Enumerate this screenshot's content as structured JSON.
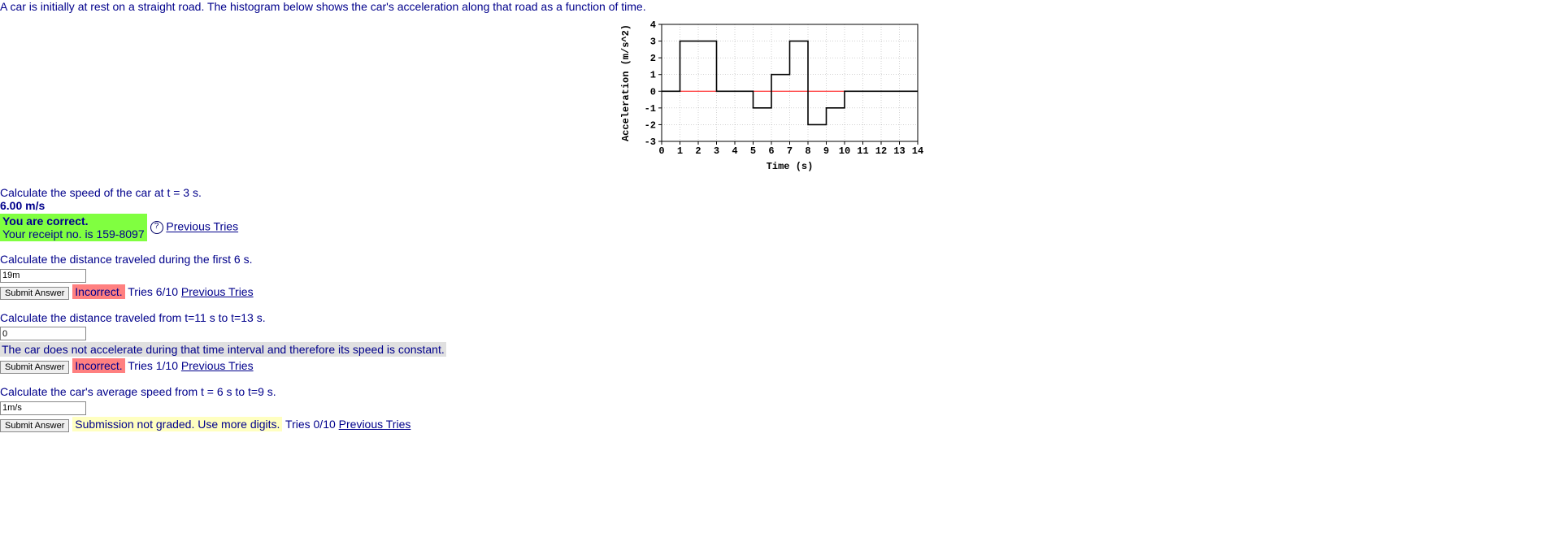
{
  "intro": "A car is initially at rest on a straight road. The histogram below shows the car's acceleration along that road as a function of time.",
  "chart_data": {
    "type": "step",
    "xlabel": "Time (s)",
    "ylabel": "Acceleration (m/s^2)",
    "xlim": [
      0,
      14
    ],
    "ylim": [
      -3,
      4
    ],
    "xticks": [
      0,
      1,
      2,
      3,
      4,
      5,
      6,
      7,
      8,
      9,
      10,
      11,
      12,
      13,
      14
    ],
    "yticks": [
      -3,
      -2,
      -1,
      0,
      1,
      2,
      3,
      4
    ],
    "segments": [
      {
        "t_start": 0,
        "t_end": 1,
        "a": 0
      },
      {
        "t_start": 1,
        "t_end": 3,
        "a": 3
      },
      {
        "t_start": 3,
        "t_end": 5,
        "a": 0
      },
      {
        "t_start": 5,
        "t_end": 6,
        "a": -1
      },
      {
        "t_start": 6,
        "t_end": 7,
        "a": 1
      },
      {
        "t_start": 7,
        "t_end": 8,
        "a": 3
      },
      {
        "t_start": 8,
        "t_end": 9,
        "a": -2
      },
      {
        "t_start": 9,
        "t_end": 10,
        "a": -1
      },
      {
        "t_start": 10,
        "t_end": 14,
        "a": 0
      }
    ]
  },
  "q1": {
    "prompt": "Calculate the speed of the car at t = 3 s.",
    "answer": "6.00 m/s",
    "correct_line1": "You are correct.",
    "correct_line2": "Your receipt no. is 159-8097",
    "prev": "Previous Tries"
  },
  "q2": {
    "prompt": "Calculate the distance traveled during the first 6 s.",
    "value": "19m",
    "submit": "Submit Answer",
    "status": "Incorrect.",
    "tries": "Tries 6/10",
    "prev": "Previous Tries"
  },
  "q3": {
    "prompt": "Calculate the distance traveled from t=11 s to t=13 s.",
    "value": "0",
    "hint": "The car does not accelerate during that time interval and therefore its speed is constant.",
    "submit": "Submit Answer",
    "status": "Incorrect.",
    "tries": "Tries 1/10",
    "prev": "Previous Tries"
  },
  "q4": {
    "prompt": "Calculate the car's average speed from t = 6 s to t=9 s.",
    "value": "1m/s",
    "submit": "Submit Answer",
    "status": "Submission not graded. Use more digits.",
    "tries": "Tries 0/10",
    "prev": "Previous Tries"
  }
}
